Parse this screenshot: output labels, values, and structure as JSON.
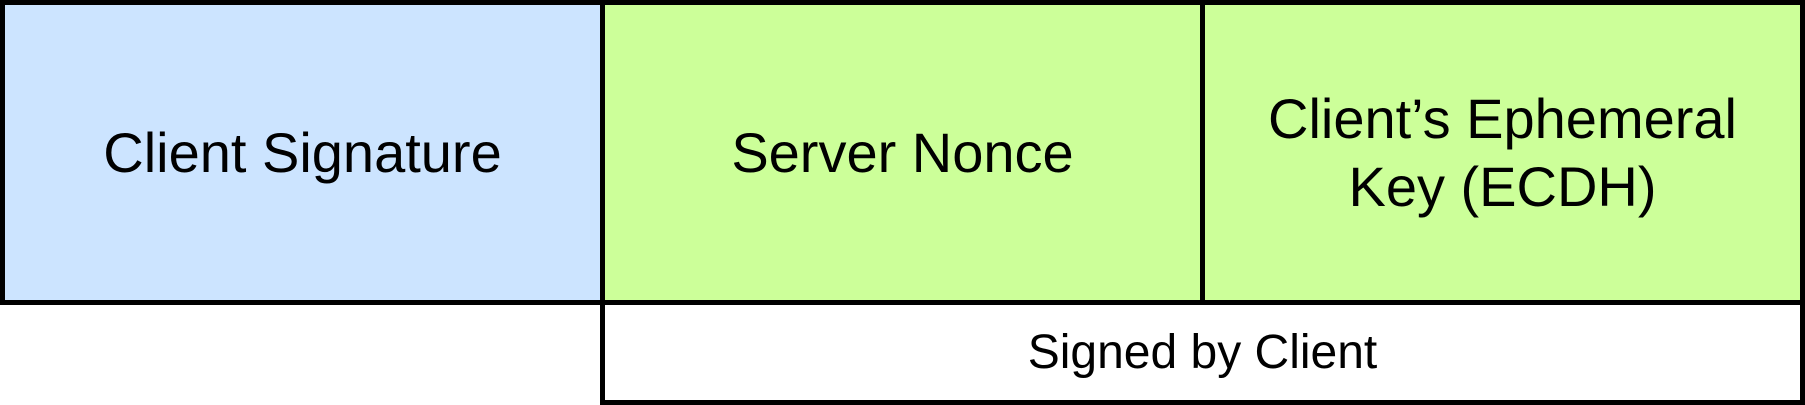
{
  "diagram": {
    "client_signature": {
      "label": "Client Signature",
      "fill": "#cce4ff"
    },
    "server_nonce": {
      "label": "Server Nonce",
      "fill": "#ccff99"
    },
    "ephemeral_key": {
      "label": "Client’s Ephemeral\nKey (ECDH)",
      "fill": "#ccff99"
    },
    "signed_by": {
      "label": "Signed by Client",
      "fill": "#ffffff"
    }
  }
}
